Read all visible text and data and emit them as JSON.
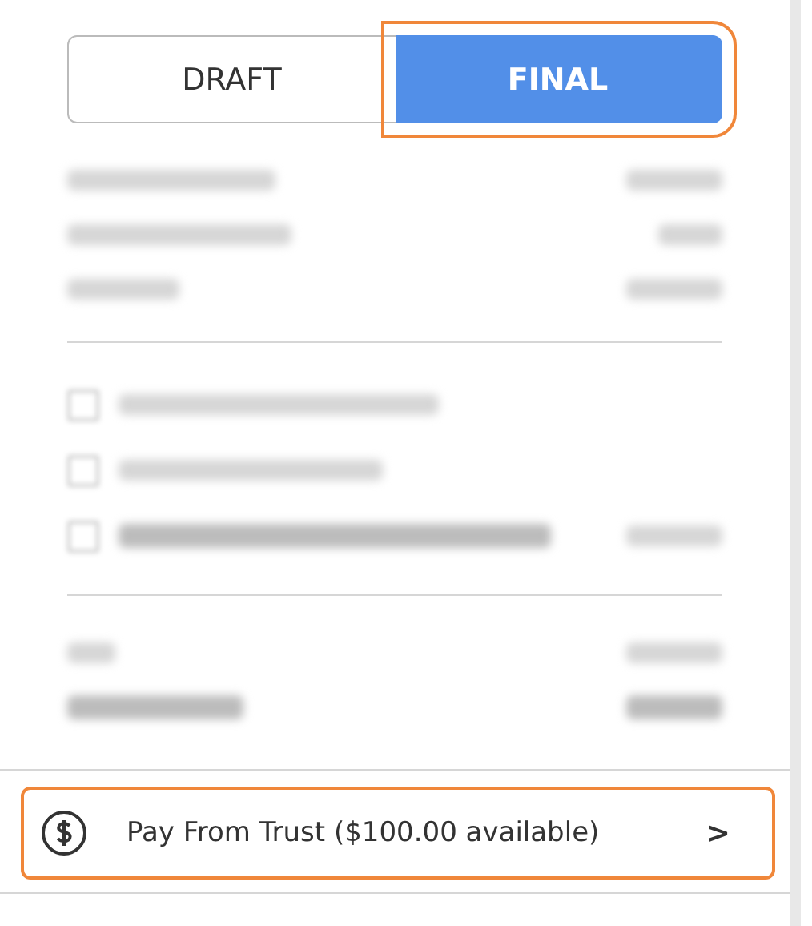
{
  "mode_toggle": [
    {
      "label": "DRAFT",
      "selected": false,
      "highlighted": false
    },
    {
      "label": "FINAL",
      "selected": true,
      "highlighted": true
    }
  ],
  "blurred_sections": [
    {
      "rows": [
        {
          "kind": "amount"
        },
        {
          "kind": "amount"
        },
        {
          "kind": "amount"
        }
      ]
    },
    {
      "rows": [
        {
          "kind": "checkbox",
          "checked": false
        },
        {
          "kind": "checkbox",
          "checked": false
        },
        {
          "kind": "checkbox_amount",
          "checked": false
        }
      ]
    },
    {
      "rows": [
        {
          "kind": "amount"
        },
        {
          "kind": "total"
        }
      ]
    }
  ],
  "pay_from_trust": {
    "label": "Pay From Trust ($100.00 available)",
    "chevron": ">",
    "highlighted": true
  }
}
